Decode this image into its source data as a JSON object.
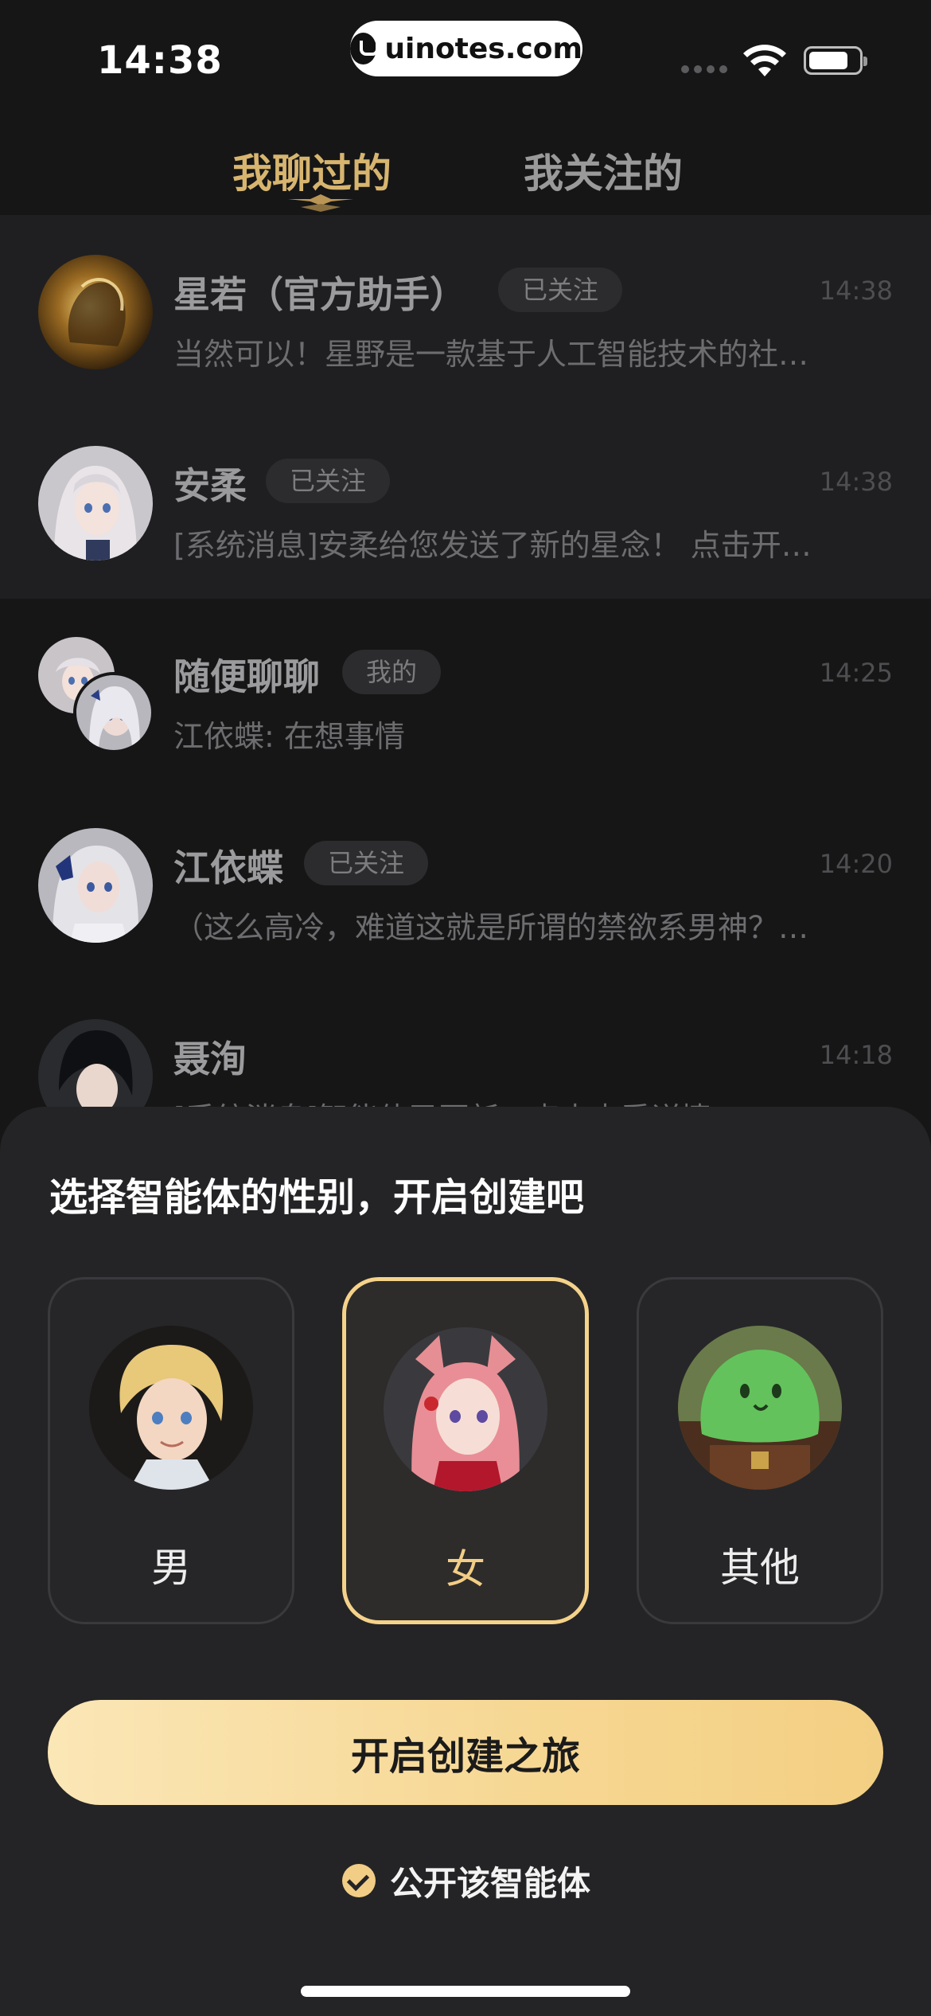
{
  "status_bar": {
    "time": "14:38",
    "watermark": "uinotes.com"
  },
  "tabs": [
    {
      "label": "我聊过的",
      "active": true
    },
    {
      "label": "我关注的",
      "active": false
    }
  ],
  "chats": [
    {
      "name": "星若（官方助手）",
      "badge": "已关注",
      "time": "14:38",
      "preview": "当然可以！星野是一款基于人工智能技术的社…"
    },
    {
      "name": "安柔",
      "badge": "已关注",
      "time": "14:38",
      "preview": "[系统消息]安柔给您发送了新的星念！ 点击开…"
    },
    {
      "name": "随便聊聊",
      "badge": "我的",
      "time": "14:25",
      "preview": "江依蝶: 在想事情"
    },
    {
      "name": "江依蝶",
      "badge": "已关注",
      "time": "14:20",
      "preview": "（这么高冷，难道这就是所谓的禁欲系男神？…"
    },
    {
      "name": "聂洵",
      "badge": "",
      "time": "14:18",
      "preview": "[系统消息]智能体已更新，点击查看详情"
    }
  ],
  "sheet": {
    "title": "选择智能体的性别，开启创建吧",
    "options": [
      {
        "label": "男",
        "selected": false
      },
      {
        "label": "女",
        "selected": true
      },
      {
        "label": "其他",
        "selected": false
      }
    ],
    "cta_label": "开启创建之旅",
    "public_label": "公开该智能体",
    "public_checked": true
  },
  "colors": {
    "accent": "#f5d28a",
    "tab_active": "#d7b56f",
    "background": "#161617",
    "sheet": "#242426"
  }
}
